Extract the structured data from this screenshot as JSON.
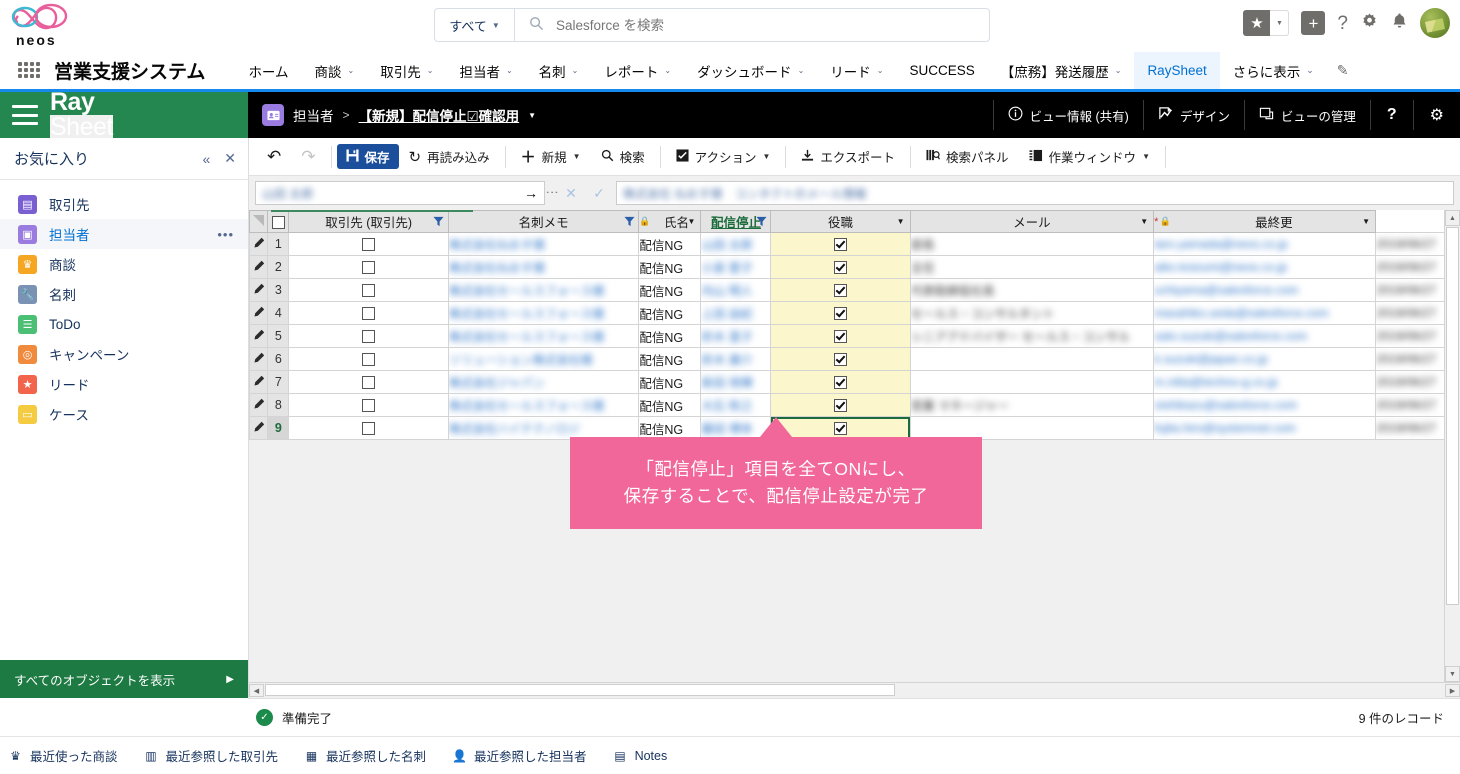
{
  "global": {
    "logo_word": "neos",
    "search": {
      "scope": "すべて",
      "placeholder": "Salesforce を検索",
      "value": ""
    },
    "icons": {
      "favorite": "star-icon",
      "favorite_caret": "chevron-down-icon",
      "add": "plus-icon",
      "help": "question-icon",
      "setup": "gear-icon",
      "notifications": "bell-icon",
      "avatar": "user-avatar"
    }
  },
  "appnav": {
    "waffle": "app-launcher-icon",
    "app_title": "営業支援システム",
    "items": [
      {
        "label": "ホーム",
        "caret": false,
        "active": false
      },
      {
        "label": "商談",
        "caret": true,
        "active": false
      },
      {
        "label": "取引先",
        "caret": true,
        "active": false
      },
      {
        "label": "担当者",
        "caret": true,
        "active": false
      },
      {
        "label": "名刺",
        "caret": true,
        "active": false
      },
      {
        "label": "レポート",
        "caret": true,
        "active": false
      },
      {
        "label": "ダッシュボード",
        "caret": true,
        "active": false
      },
      {
        "label": "リード",
        "caret": true,
        "active": false
      },
      {
        "label": "SUCCESS",
        "caret": false,
        "active": false
      },
      {
        "label": "【庶務】発送履歴",
        "caret": true,
        "active": false
      },
      {
        "label": "RaySheet",
        "caret": false,
        "active": true
      },
      {
        "label": "さらに表示",
        "caret": true,
        "active": false
      }
    ],
    "edit_icon": "pencil-icon"
  },
  "raysheet": {
    "menu_icon": "hamburger-icon",
    "logo": {
      "ray": "Ray",
      "sheet": "Sheet"
    },
    "breadcrumb": {
      "object_icon": "contact-object-icon",
      "object": "担当者",
      "separator": ">",
      "view": "【新規】配信停止☑確認用",
      "caret": "chevron-down-icon"
    },
    "actions": [
      {
        "label": "ビュー情報 (共有)",
        "icon": "info-icon"
      },
      {
        "label": "デザイン",
        "icon": "design-icon"
      },
      {
        "label": "ビューの管理",
        "icon": "view-manage-icon"
      },
      {
        "label": "?",
        "icon": "help-icon"
      },
      {
        "label": "⚙",
        "icon": "gear-icon"
      }
    ]
  },
  "toolbar": {
    "undo": "↶",
    "redo": "↷",
    "save": "保存",
    "reload": "再読み込み",
    "new": "新規",
    "search": "検索",
    "action": "アクション",
    "export": "エクスポート",
    "search_panel": "検索パネル",
    "work_window": "作業ウィンドウ"
  },
  "formula_row": {
    "namebox_value": "",
    "cancel_icon": "close-icon",
    "confirm_icon": "check-icon",
    "formula_value": ""
  },
  "sidebar": {
    "title": "お気に入り",
    "collapse_icon": "chevrons-left-icon",
    "close_icon": "close-icon",
    "items": [
      {
        "label": "取引先",
        "icon": "account-icon",
        "color": "#7a5fd3",
        "glyph": "▤",
        "active": false,
        "menu": false
      },
      {
        "label": "担当者",
        "icon": "contact-icon",
        "color": "#9a7ce0",
        "glyph": "▣",
        "active": true,
        "menu": true
      },
      {
        "label": "商談",
        "icon": "opportunity-icon",
        "color": "#f5a623",
        "glyph": "♛",
        "active": false,
        "menu": false
      },
      {
        "label": "名刺",
        "icon": "businesscard-icon",
        "color": "#7a93b5",
        "glyph": "🔧",
        "active": false,
        "menu": false
      },
      {
        "label": "ToDo",
        "icon": "task-icon",
        "color": "#4bbf73",
        "glyph": "☰",
        "active": false,
        "menu": false
      },
      {
        "label": "キャンペーン",
        "icon": "campaign-icon",
        "color": "#f08a3c",
        "glyph": "◎",
        "active": false,
        "menu": false
      },
      {
        "label": "リード",
        "icon": "lead-icon",
        "color": "#f2654c",
        "glyph": "★",
        "active": false,
        "menu": false
      },
      {
        "label": "ケース",
        "icon": "case-icon",
        "color": "#f5cb42",
        "glyph": "▭",
        "active": false,
        "menu": false
      }
    ],
    "footer": {
      "label": "すべてのオブジェクトを表示",
      "arrow": "▶"
    },
    "menu_dots": "•••"
  },
  "grid": {
    "select_all": "select-all-checkbox",
    "columns": [
      {
        "label": "取引先 (取引先)",
        "filter": "filter-icon",
        "highlight": false
      },
      {
        "label": "名刺メモ",
        "filter": "filter-icon",
        "highlight": false
      },
      {
        "label": "氏名",
        "filter": "caret-icon",
        "lock": true,
        "highlight": false
      },
      {
        "label": "配信停止",
        "filter": "filter-icon",
        "highlight": true
      },
      {
        "label": "役職",
        "filter": "caret-icon",
        "highlight": false
      },
      {
        "label": "メール",
        "filter": "caret-icon",
        "highlight": false
      },
      {
        "label": "最終更",
        "filter": "caret-icon",
        "lock": true,
        "required": true,
        "highlight": false
      }
    ],
    "rows": [
      {
        "num": "1",
        "memo": "配信NG",
        "stop": true,
        "selected": false
      },
      {
        "num": "2",
        "memo": "配信NG",
        "stop": true,
        "selected": false
      },
      {
        "num": "3",
        "memo": "配信NG",
        "stop": true,
        "selected": false
      },
      {
        "num": "4",
        "memo": "配信NG",
        "stop": true,
        "selected": false
      },
      {
        "num": "5",
        "memo": "配信NG",
        "stop": true,
        "selected": false
      },
      {
        "num": "6",
        "memo": "配信NG",
        "stop": true,
        "selected": false
      },
      {
        "num": "7",
        "memo": "配信NG",
        "stop": true,
        "selected": false
      },
      {
        "num": "8",
        "memo": "配信NG",
        "stop": true,
        "selected": false
      },
      {
        "num": "9",
        "memo": "配信NG",
        "stop": true,
        "selected": true
      }
    ]
  },
  "callout": {
    "line1": "「配信停止」項目を全てONにし、",
    "line2": "保存することで、配信停止設定が完了",
    "color": "#f2679a"
  },
  "status": {
    "icon": "success-check-icon",
    "text": "準備完了",
    "record_count": "9 件のレコード"
  },
  "footer": {
    "items": [
      {
        "label": "最近使った商談",
        "icon": "opportunity-icon"
      },
      {
        "label": "最近参照した取引先",
        "icon": "account-icon"
      },
      {
        "label": "最近参照した名刺",
        "icon": "card-icon"
      },
      {
        "label": "最近参照した担当者",
        "icon": "contact-icon"
      },
      {
        "label": "Notes",
        "icon": "notes-icon"
      }
    ]
  }
}
